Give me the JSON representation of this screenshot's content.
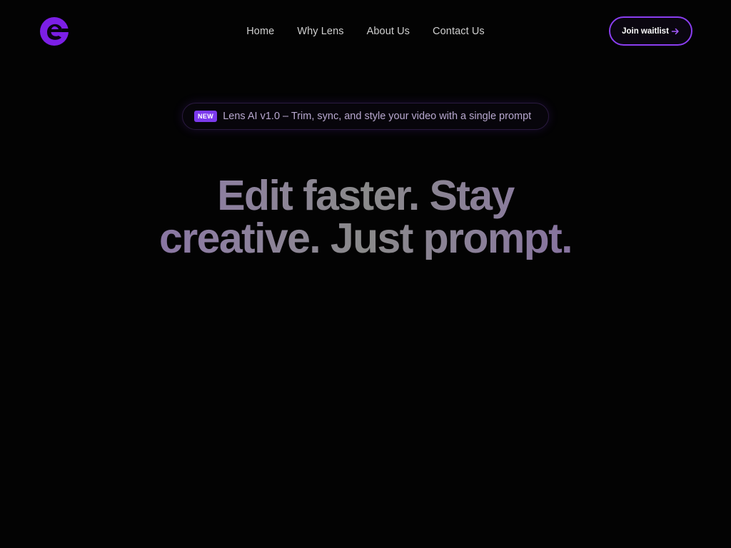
{
  "header": {
    "nav": [
      {
        "label": "Home"
      },
      {
        "label": "Why Lens"
      },
      {
        "label": "About Us"
      },
      {
        "label": "Contact Us"
      }
    ],
    "cta_label": "Join waitlist"
  },
  "announcement": {
    "badge": "NEW",
    "text": "Lens AI v1.0 – Trim, sync, and style your video with a single prompt"
  },
  "hero": {
    "line1": "Edit faster. Stay",
    "line2": "creative. Just prompt."
  },
  "colors": {
    "accent": "#7c3aed",
    "background": "#030303"
  },
  "icons": {
    "logo": "brand-logo-icon",
    "cta_arrow": "arrow-right-icon"
  }
}
